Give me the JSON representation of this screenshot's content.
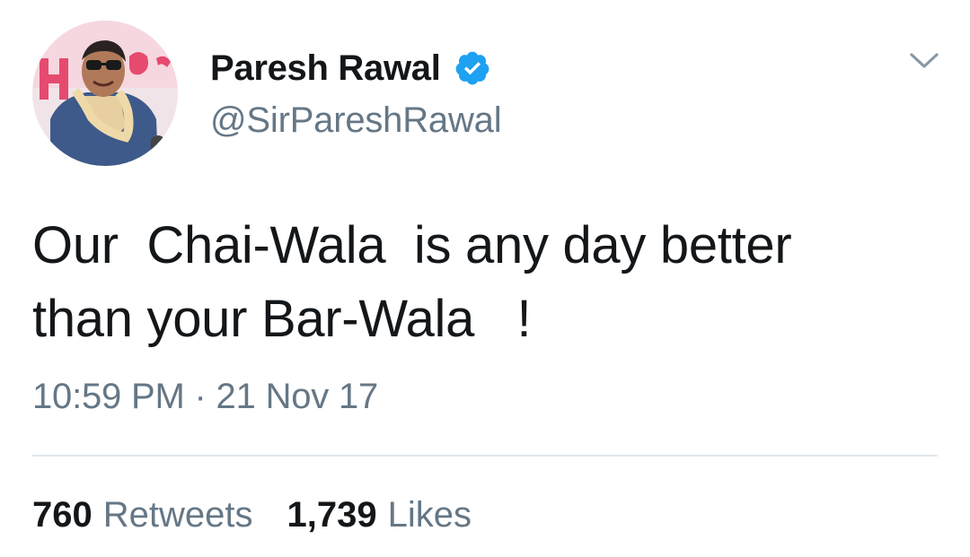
{
  "author": {
    "display_name": "Paresh Rawal",
    "handle": "@SirPareshRawal",
    "verified": true
  },
  "tweet": {
    "text": "Our  Chai-Wala  is any day better\nthan your Bar-Wala   !",
    "timestamp": "10:59 PM · 21 Nov 17"
  },
  "stats": {
    "retweets_count": "760",
    "retweets_label": "Retweets",
    "likes_count": "1,739",
    "likes_label": "Likes"
  },
  "icons": {
    "verified": "verified-badge-icon",
    "menu": "chevron-down-icon"
  },
  "colors": {
    "verified_blue": "#1da1f2",
    "secondary_text": "#657786",
    "primary_text": "#14171a",
    "divider": "#e1e8ed"
  }
}
